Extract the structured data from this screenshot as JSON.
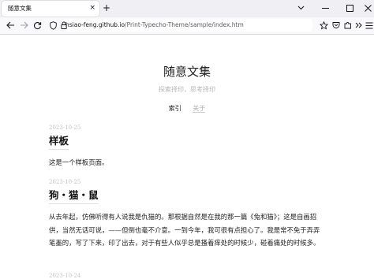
{
  "browser": {
    "tab_title": "随意文集",
    "tab_close": "×",
    "new_tab": "+",
    "url_host": "hsiao-feng.github.io",
    "url_path": "/Print-Typecho-Theme/sample/index.htm"
  },
  "site": {
    "title": "随意文集",
    "description": "探索择印，思考择印",
    "nav": [
      {
        "label": "索引"
      },
      {
        "label": "关于"
      }
    ]
  },
  "posts": [
    {
      "date": "2023-10-25",
      "title": "样板",
      "body": "这是一个样板页面。"
    },
    {
      "date": "2023-10-25",
      "title": "狗・猫・鼠",
      "body": "从去年起，仿佛听得有人说我是仇猫的。那根据自然是在我的那一篇《兔和猫》；这是自画招供，当然无话可说，——但倒也毫不介意。一到今年，我可很有点担心了。我是常不免于弄弄笔墨的，写了下来，印了出去，对于有些人似乎总是搔着痒处的时候少，碰着痛处的时候多。"
    },
    {
      "date": "2023-10-24"
    }
  ],
  "colors": {
    "chrome_bg": "#f0f0f4",
    "toolbar_bg": "#f9f9fb",
    "date_color": "#c2c2c2",
    "muted_text": "#b5b5b5"
  },
  "icons": [
    "back-arrow-icon",
    "forward-arrow-icon",
    "reload-icon",
    "shield-icon",
    "lock-icon",
    "star-icon",
    "pocket-icon",
    "extensions-icon",
    "overflow-icon",
    "menu-icon",
    "list-all-tabs-icon",
    "minimize-icon",
    "maximize-icon",
    "close-icon"
  ]
}
